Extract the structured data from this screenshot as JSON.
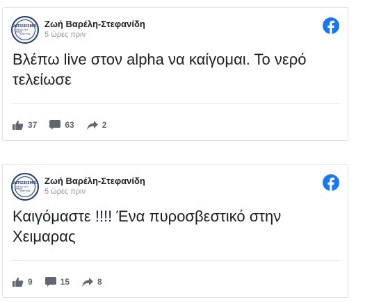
{
  "posts": [
    {
      "author": "Ζωή Βαρέλη-Στεφανίδη",
      "time": "5 ώρες πριν",
      "text": "Βλέπω live στον alpha να καίγομαι. Το νερό τελείωσε",
      "likes": "37",
      "comments": "63",
      "shares": "2",
      "avatar_lines": [
        "ΑΝΤΙΣΕΙΣΜΟΣ",
        "ΟΜΑΔΑ ΤΟΥ ΡΕΣΚΕ",
        "ΕΧΕΙ ΤΗΝ"
      ]
    },
    {
      "author": "Ζωή Βαρέλη-Στεφανίδη",
      "time": "5 ώρες πριν",
      "text": "Καιγόμαστε !!!! Ένα πυροσβεστικό στην Χειμαρας",
      "likes": "9",
      "comments": "15",
      "shares": "8",
      "avatar_lines": [
        "ΑΝΤΙΣΕΙΣΜΟΣ",
        "ΟΜΑΔΑ ΤΟΥ ΡΕΣΚΕ",
        "ΕΧΕΙ ΤΗΝ"
      ]
    }
  ],
  "colors": {
    "facebook_blue": "#1877f2",
    "text": "#1c1e21",
    "muted": "#90949c",
    "icon": "#606770",
    "border": "#dddfe2"
  },
  "icons": {
    "platform": "facebook-icon",
    "like": "thumbs-up-icon",
    "comment": "comment-bubble-icon",
    "share": "share-arrow-icon"
  }
}
